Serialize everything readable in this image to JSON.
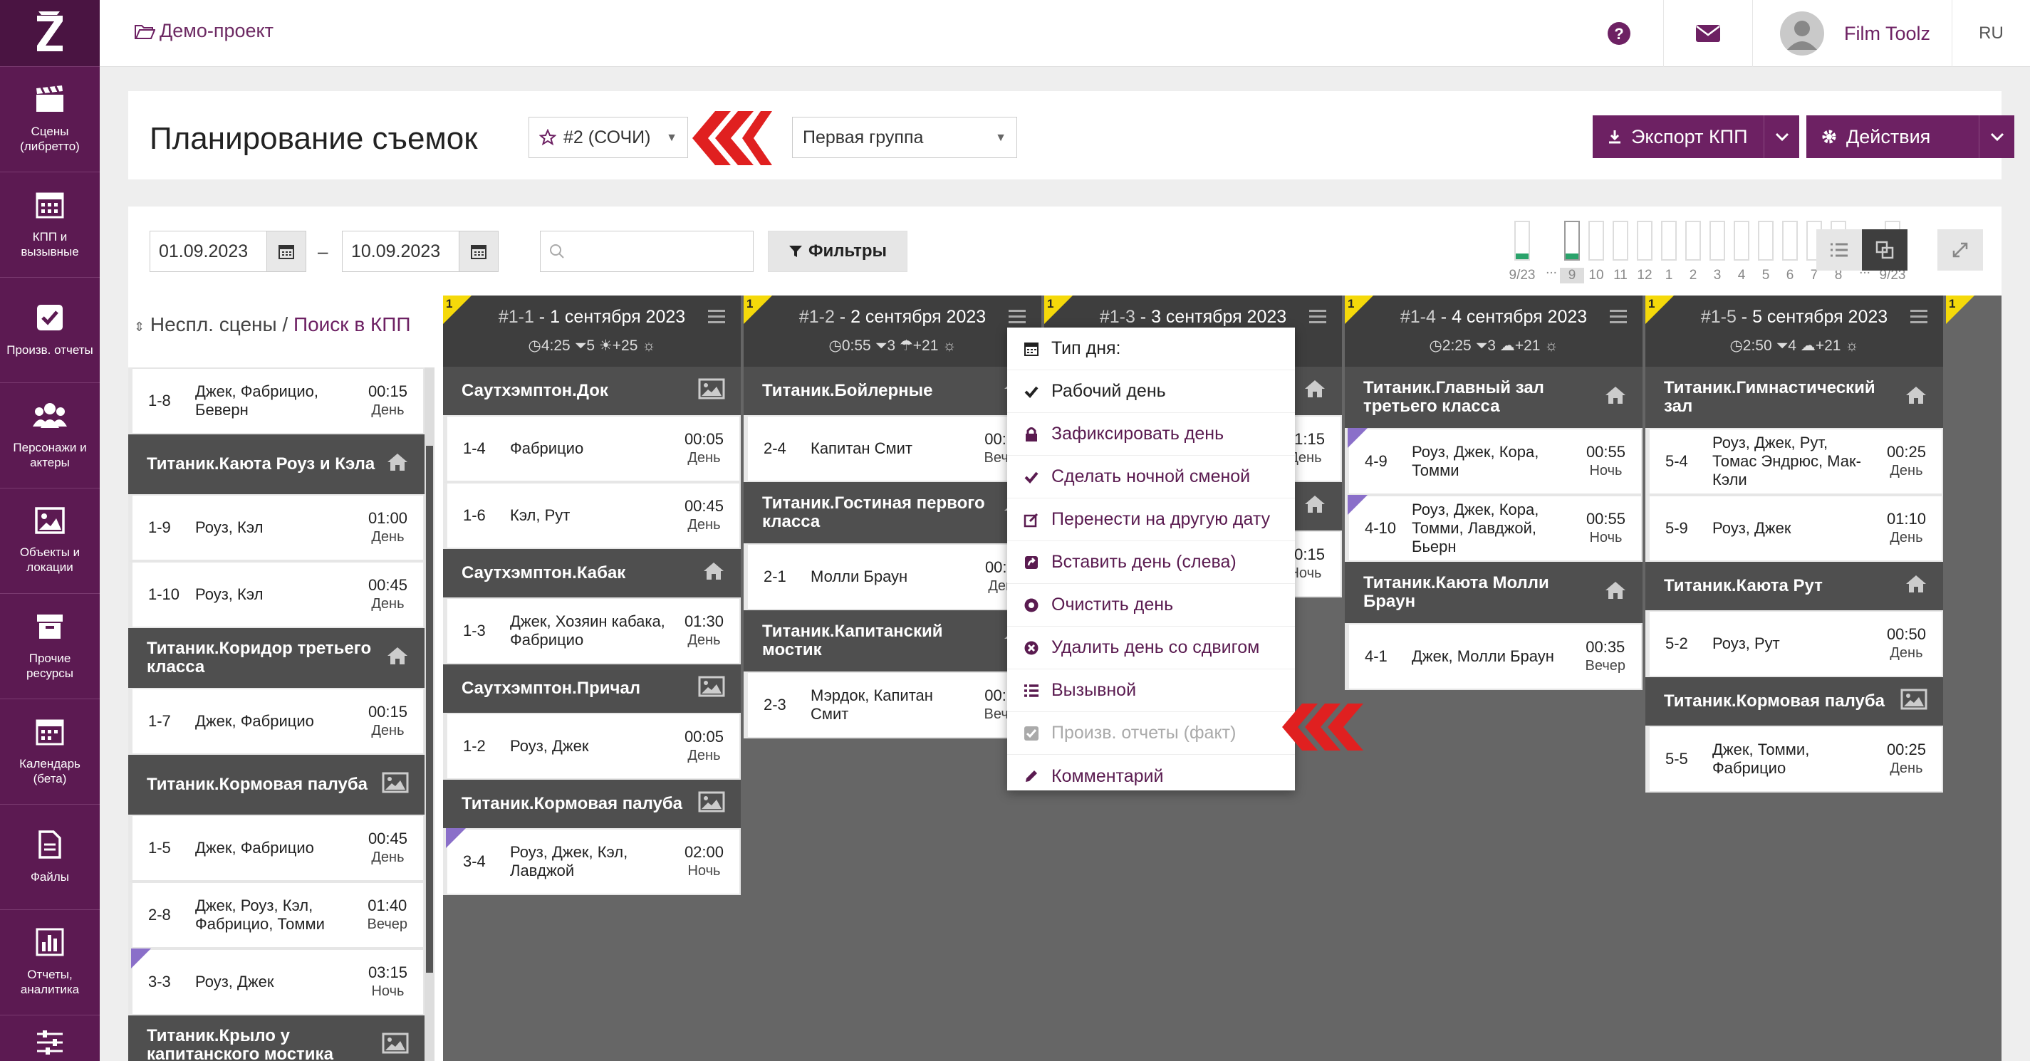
{
  "sidebar": {
    "logo": "Z",
    "items": [
      {
        "label": "Сцены\n(либретто)",
        "icon": "clapperboard-icon"
      },
      {
        "label": "КПП и\nвызывные",
        "icon": "calendar-grid-icon"
      },
      {
        "label": "Произв. отчеты",
        "icon": "checkbox-icon"
      },
      {
        "label": "Персонажи и\nактеры",
        "icon": "people-icon"
      },
      {
        "label": "Объекты и\nлокации",
        "icon": "image-icon"
      },
      {
        "label": "Прочие\nресурсы",
        "icon": "box-icon"
      },
      {
        "label": "Календарь\n(бета)",
        "icon": "calendar-icon"
      },
      {
        "label": "Файлы",
        "icon": "file-icon"
      },
      {
        "label": "Отчеты,\nаналитика",
        "icon": "bar-chart-icon"
      },
      {
        "label": "",
        "icon": "sliders-icon"
      }
    ]
  },
  "topbar": {
    "project": "Демо-проект",
    "user": "Film Toolz",
    "lang": "RU"
  },
  "header": {
    "title": "Планирование съемок",
    "unit_select": "#2 (СОЧИ)",
    "group_select": "Первая группа",
    "export_label": "Экспорт КПП",
    "actions_label": "Действия"
  },
  "toolbar": {
    "date_from": "01.09.2023",
    "date_sep": "–",
    "date_to": "10.09.2023",
    "search_placeholder": "",
    "filters_label": "Фильтры"
  },
  "timeline": {
    "bars": [
      {
        "label": "9/23",
        "fill": 0.15
      },
      {
        "label": "9",
        "fill": 0.15,
        "selected": true
      },
      {
        "label": "10",
        "fill": 0
      },
      {
        "label": "11",
        "fill": 0
      },
      {
        "label": "12",
        "fill": 0
      },
      {
        "label": "1",
        "fill": 0
      },
      {
        "label": "2",
        "fill": 0
      },
      {
        "label": "3",
        "fill": 0
      },
      {
        "label": "4",
        "fill": 0
      },
      {
        "label": "5",
        "fill": 0
      },
      {
        "label": "6",
        "fill": 0
      },
      {
        "label": "7",
        "fill": 0
      },
      {
        "label": "8",
        "fill": 0
      },
      {
        "label": "9/23",
        "fill": 0.15
      }
    ],
    "ellipsis": "..."
  },
  "unscheduled": {
    "label": "Неспл. сцены",
    "sep": " / ",
    "link": "Поиск в КПП",
    "blocks": [
      {
        "location": null,
        "scenes": [
          {
            "num": "1-8",
            "chars": "Джек, Фабрицио, Беверн",
            "time": "00:15",
            "shift": "День"
          }
        ]
      },
      {
        "location": "Титаник.Каюта Роуз и Кэла",
        "icon": "home",
        "scenes": [
          {
            "num": "1-9",
            "chars": "Роуз, Кэл",
            "time": "01:00",
            "shift": "День"
          },
          {
            "num": "1-10",
            "chars": "Роуз, Кэл",
            "time": "00:45",
            "shift": "День"
          }
        ]
      },
      {
        "location": "Титаник.Коридор третьего класса",
        "icon": "home",
        "scenes": [
          {
            "num": "1-7",
            "chars": "Джек, Фабрицио",
            "time": "00:15",
            "shift": "День"
          }
        ]
      },
      {
        "location": "Титаник.Кормовая палуба",
        "icon": "image",
        "scenes": [
          {
            "num": "1-5",
            "chars": "Джек, Фабрицио",
            "time": "00:45",
            "shift": "День"
          },
          {
            "num": "2-8",
            "chars": "Джек, Роуз, Кэл, Фабрицио, Томми",
            "time": "01:40",
            "shift": "Вечер"
          },
          {
            "num": "3-3",
            "chars": "Роуз, Джек",
            "time": "03:15",
            "shift": "Ночь",
            "corner": true
          }
        ]
      },
      {
        "location": "Титаник.Крыло у капитанского мостика",
        "icon": "image",
        "scenes": []
      }
    ]
  },
  "days": [
    {
      "num": "#1-1",
      "title": "1 сентября 2023",
      "badge": "1",
      "dur": "4:25",
      "scenes_count": "5",
      "weather": "sun",
      "temp": "+25",
      "blocks": [
        {
          "location": "Саутхэмптон.Док",
          "icon": "image",
          "scenes": [
            {
              "num": "1-4",
              "chars": "Фабрицио",
              "time": "00:05",
              "shift": "День"
            },
            {
              "num": "1-6",
              "chars": "Кэл, Рут",
              "time": "00:45",
              "shift": "День"
            }
          ]
        },
        {
          "location": "Саутхэмптон.Кабак",
          "icon": "home",
          "scenes": [
            {
              "num": "1-3",
              "chars": "Джек, Хозяин кабака, Фабрицио",
              "time": "01:30",
              "shift": "День"
            }
          ]
        },
        {
          "location": "Саутхэмптон.Причал",
          "icon": "image",
          "scenes": [
            {
              "num": "1-2",
              "chars": "Роуз, Джек",
              "time": "00:05",
              "shift": "День"
            }
          ]
        },
        {
          "location": "Титаник.Кормовая палуба",
          "icon": "image",
          "scenes": [
            {
              "num": "3-4",
              "chars": "Роуз, Джек, Кэл, Лавджой",
              "time": "02:00",
              "shift": "Ночь",
              "corner": true
            }
          ]
        }
      ]
    },
    {
      "num": "#1-2",
      "title": "2 сентября 2023",
      "badge": "1",
      "dur": "0:55",
      "scenes_count": "3",
      "weather": "rain",
      "temp": "+21",
      "blocks": [
        {
          "location": "Титаник.Бойлерные",
          "icon": "home",
          "scenes": [
            {
              "num": "2-4",
              "chars": "Капитан Смит",
              "time": "00:10",
              "shift": "Вечер"
            }
          ]
        },
        {
          "location": "Титаник.Гостиная первого класса",
          "icon": "home",
          "scenes": [
            {
              "num": "2-1",
              "chars": "Молли Браун",
              "time": "00:20",
              "shift": "День"
            }
          ]
        },
        {
          "location": "Титаник.Капитанский мостик",
          "icon": "home",
          "scenes": [
            {
              "num": "2-3",
              "chars": "Мэрдок, Капитан Смит",
              "time": "00:10",
              "shift": "Вечер"
            }
          ]
        }
      ]
    },
    {
      "num": "#1-3",
      "title": "3 сентября 2023",
      "badge": "1",
      "dur": "",
      "scenes_count": "",
      "weather": "",
      "temp": "",
      "blocks": [
        {
          "location": "",
          "icon": "home",
          "scenes": [
            {
              "num": "",
              "chars": "",
              "time": "01:15",
              "shift": "День"
            }
          ]
        },
        {
          "location": "",
          "icon": "home",
          "scenes": [
            {
              "num": "",
              "chars": "",
              "time": "00:15",
              "shift": "Ночь"
            }
          ]
        }
      ]
    },
    {
      "num": "#1-4",
      "title": "4 сентября 2023",
      "badge": "1",
      "dur": "2:25",
      "scenes_count": "3",
      "weather": "cloud",
      "temp": "+21",
      "blocks": [
        {
          "location": "Титаник.Главный зал третьего класса",
          "icon": "home",
          "scenes": [
            {
              "num": "4-9",
              "chars": "Роуз, Джек, Кора, Томми",
              "time": "00:55",
              "shift": "Ночь",
              "corner": true
            },
            {
              "num": "4-10",
              "chars": "Роуз, Джек, Кора, Томми, Лавджой, Бьерн",
              "time": "00:55",
              "shift": "Ночь",
              "corner": true
            }
          ]
        },
        {
          "location": "Титаник.Каюта Молли Браун",
          "icon": "home",
          "scenes": [
            {
              "num": "4-1",
              "chars": "Джек, Молли Браун",
              "time": "00:35",
              "shift": "Вечер"
            }
          ]
        }
      ]
    },
    {
      "num": "#1-5",
      "title": "5 сентября 2023",
      "badge": "1",
      "dur": "2:50",
      "scenes_count": "4",
      "weather": "cloud",
      "temp": "+21",
      "blocks": [
        {
          "location": "Титаник.Гимнастический зал",
          "icon": "home",
          "scenes": [
            {
              "num": "5-4",
              "chars": "Роуз, Джек, Рут, Томас Эндрюс, Мак-Кэли",
              "time": "00:25",
              "shift": "День"
            },
            {
              "num": "5-9",
              "chars": "Роуз, Джек",
              "time": "01:10",
              "shift": "День"
            }
          ]
        },
        {
          "location": "Титаник.Каюта Рут",
          "icon": "home",
          "scenes": [
            {
              "num": "5-2",
              "chars": "Роуз, Рут",
              "time": "00:50",
              "shift": "День"
            }
          ]
        },
        {
          "location": "Титаник.Кормовая палуба",
          "icon": "image",
          "scenes": [
            {
              "num": "5-5",
              "chars": "Джек, Томми, Фабрицио",
              "time": "00:25",
              "shift": "День"
            }
          ]
        }
      ]
    }
  ],
  "context_menu": {
    "header": "Тип дня:",
    "items": [
      {
        "label": "Рабочий день",
        "icon": "check-icon",
        "style": "black"
      },
      {
        "label": "Зафиксировать день",
        "icon": "lock-icon",
        "style": "purple"
      },
      {
        "label": "Сделать ночной сменой",
        "icon": "check-icon",
        "style": "purple"
      },
      {
        "label": "Перенести на другую дату",
        "icon": "edit-icon",
        "style": "purple"
      },
      {
        "label": "Вставить день (слева)",
        "icon": "share-icon",
        "style": "purple"
      },
      {
        "label": "Очистить день",
        "icon": "clear-icon",
        "style": "purple"
      },
      {
        "label": "Удалить день со сдвигом",
        "icon": "remove-icon",
        "style": "purple"
      },
      {
        "label": "Вызывной",
        "icon": "list-icon",
        "style": "purple"
      },
      {
        "label": "Произв. отчеты (факт)",
        "icon": "checkbox-icon",
        "style": "disabled"
      },
      {
        "label": "Комментарий",
        "icon": "pencil-icon",
        "style": "purple"
      }
    ]
  },
  "colors": {
    "brand": "#6d2163",
    "sidebar": "#5c1a52",
    "accent_red": "#e02020",
    "badge_yellow": "#f5d90a"
  }
}
